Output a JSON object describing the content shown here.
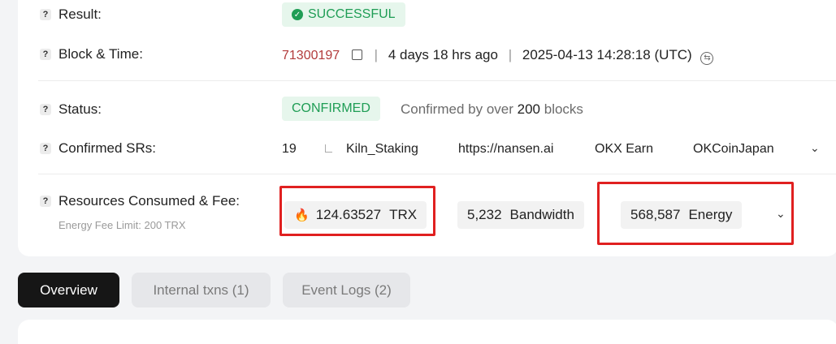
{
  "result": {
    "label": "Result:",
    "value": "SUCCESSFUL"
  },
  "block_time": {
    "label": "Block & Time:",
    "block": "71300197",
    "sep": "|",
    "age": "4 days 18 hrs ago",
    "datetime": "2025-04-13 14:28:18 (UTC)"
  },
  "status": {
    "label": "Status:",
    "value": "CONFIRMED",
    "note_prefix": "Confirmed by over",
    "note_count": "200",
    "note_suffix": "blocks"
  },
  "confirmed_srs": {
    "label": "Confirmed SRs:",
    "count": "19",
    "items": [
      "Kiln_Staking",
      "https://nansen.ai",
      "OKX Earn",
      "OKCoinJapan"
    ]
  },
  "resources": {
    "label": "Resources Consumed & Fee:",
    "sub_label": "Energy Fee Limit: 200 TRX",
    "fee_amount": "124.63527",
    "fee_unit": "TRX",
    "bandwidth_amount": "5,232",
    "bandwidth_unit": "Bandwidth",
    "energy_amount": "568,587",
    "energy_unit": "Energy"
  },
  "tabs": [
    {
      "label": "Overview",
      "active": true
    },
    {
      "label": "Internal txns (1)",
      "active": false
    },
    {
      "label": "Event Logs (2)",
      "active": false
    }
  ],
  "colors": {
    "success": "#1f9d55",
    "highlight": "#e02020",
    "link": "#b23b3b"
  }
}
